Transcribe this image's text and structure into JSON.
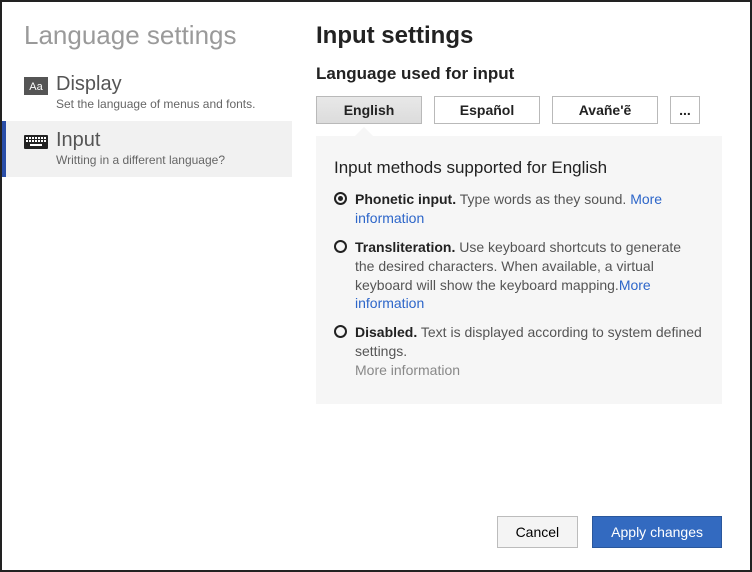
{
  "sidebar": {
    "title": "Language settings",
    "items": [
      {
        "label": "Display",
        "desc": "Set the language of menus and fonts."
      },
      {
        "label": "Input",
        "desc": "Writting in a different language?"
      }
    ]
  },
  "main": {
    "title": "Input settings",
    "subtitle": "Language used for input",
    "tabs": [
      {
        "label": "English"
      },
      {
        "label": "Español"
      },
      {
        "label": "Avañe'ẽ"
      },
      {
        "label": "..."
      }
    ],
    "panel_title": "Input methods supported for English",
    "options": [
      {
        "label": "Phonetic input.",
        "desc": "Type words as they sound. ",
        "more": "More information"
      },
      {
        "label": "Transliteration.",
        "desc": "Use keyboard shortcuts to generate the desired characters. When available, a virtual keyboard will show the keyboard mapping.",
        "more": "More information"
      },
      {
        "label": "Disabled.",
        "desc": "Text is displayed according to system defined settings.",
        "more": "More information"
      }
    ]
  },
  "footer": {
    "cancel": "Cancel",
    "apply": "Apply changes"
  }
}
